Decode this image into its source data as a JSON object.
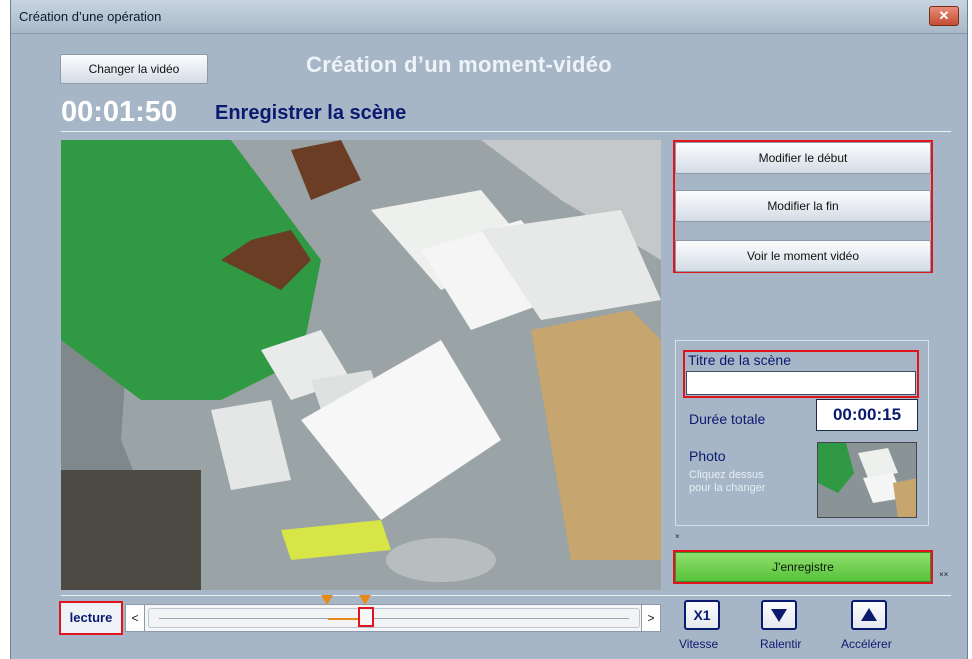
{
  "window": {
    "title": "Création d’une opération",
    "close_label": "✕"
  },
  "header": {
    "change_video_label": "Changer la vidéo",
    "main_title": "Création d’un moment-vidéo",
    "timer": "00:01:50",
    "scene_heading": "Enregistrer la scène"
  },
  "actions": {
    "modify_start": "Modifier le début",
    "modify_end": "Modifier la fin",
    "view_moment": "Voir le moment vidéo"
  },
  "scene": {
    "title_label": "Titre de la scène",
    "title_value": "",
    "duration_label": "Durée totale",
    "duration_value": "00:00:15",
    "photo_label": "Photo",
    "photo_hint_line1": "Cliquez dessus",
    "photo_hint_line2": "pour la changer"
  },
  "save_label": "J'enregistre",
  "marks": {
    "small1": "×",
    "small2": "××"
  },
  "playback": {
    "mode_label": "lecture",
    "prev_arrow": "<",
    "next_arrow": ">",
    "position_fraction": 0.44,
    "selection_start_fraction": 0.36,
    "selection_end_fraction": 0.44,
    "speed_value": "X1",
    "speed_label": "Vitesse",
    "slow_label": "Ralentir",
    "fast_label": "Accélérer"
  },
  "colors": {
    "accent_red": "#e0141c",
    "save_green": "#58c23a",
    "heading_blue": "#0a1a6e",
    "marker_orange": "#e88a1a"
  },
  "icons": [
    "close-icon",
    "down-triangle-icon",
    "up-triangle-icon"
  ]
}
